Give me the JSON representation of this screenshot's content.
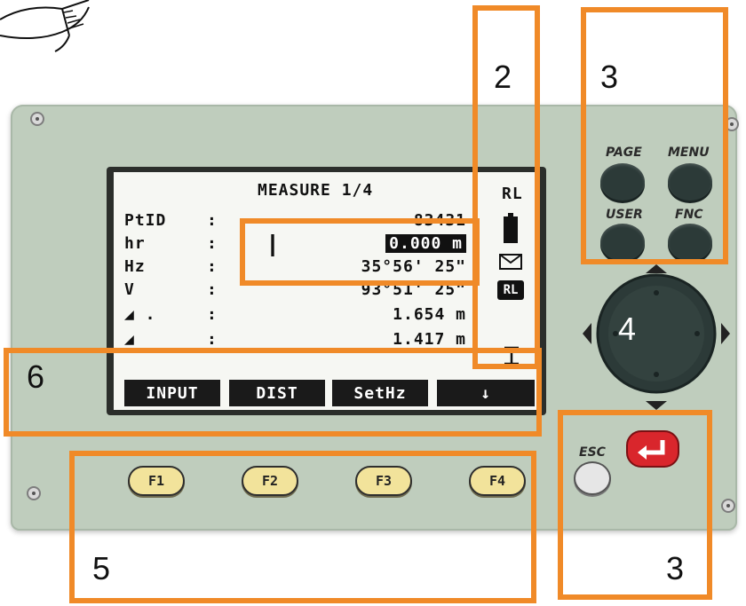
{
  "lcd": {
    "title": "MEASURE 1/4",
    "indicator_text": "RL",
    "rows": [
      {
        "label": "PtID",
        "value": "83431"
      },
      {
        "label": "hr",
        "value": "0.000 m"
      },
      {
        "label": "Hz",
        "value": "35°56' 25\""
      },
      {
        "label": "V",
        "value": "93°51' 25\""
      },
      {
        "label": "◢ .",
        "value": "1.654 m"
      },
      {
        "label": "◢",
        "value": "1.417 m"
      }
    ],
    "colon": ":",
    "status_icons": [
      "battery-icon",
      "envelope-icon",
      "rl-badge-icon",
      "compensator-icon"
    ],
    "rl_badge": "RL",
    "softkeys": [
      "INPUT",
      "DIST",
      "SetHz",
      "↓"
    ]
  },
  "keys": {
    "page": "PAGE",
    "menu": "MENU",
    "user": "USER",
    "fnc": "FNC",
    "esc": "ESC",
    "function_keys": [
      "F1",
      "F2",
      "F3",
      "F4"
    ]
  },
  "annotations": {
    "box1": "I",
    "box2": "2",
    "box3_top": "3",
    "box3_bottom": "3",
    "box4": "4",
    "box5": "5",
    "box6": "6"
  },
  "colors": {
    "annotation": "#f08a28",
    "device": "#bfcdbd",
    "fkey": "#f2e39b",
    "enter": "#d9262c"
  }
}
